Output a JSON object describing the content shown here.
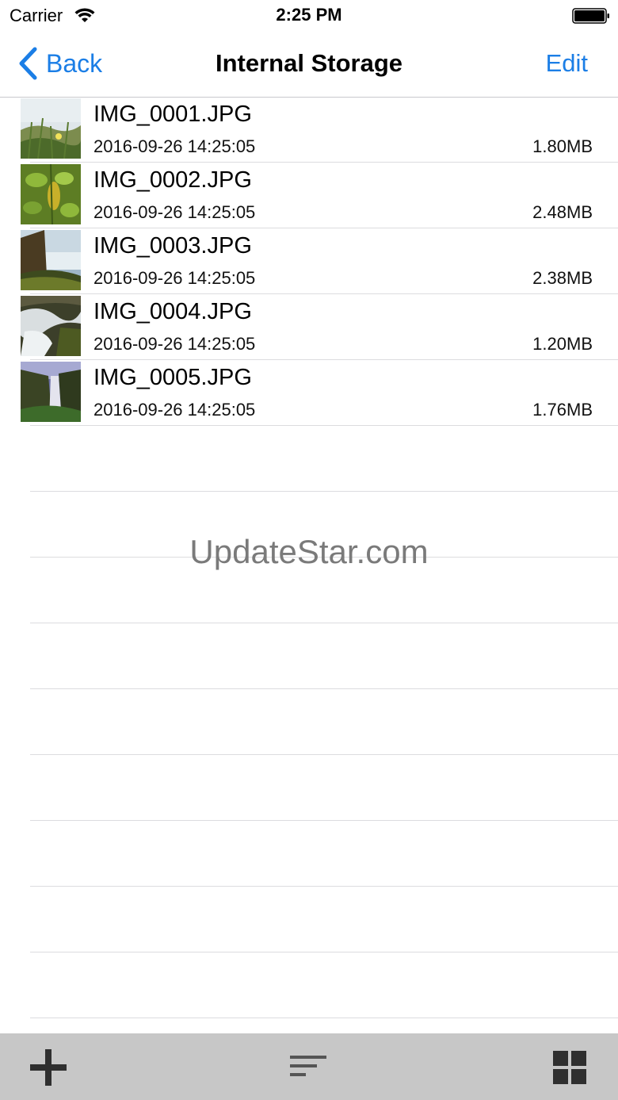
{
  "status_bar": {
    "carrier": "Carrier",
    "time": "2:25 PM"
  },
  "nav": {
    "back_label": "Back",
    "title": "Internal Storage",
    "edit_label": "Edit"
  },
  "files": [
    {
      "name": "IMG_0001.JPG",
      "date": "2016-09-26 14:25:05",
      "size": "1.80MB"
    },
    {
      "name": "IMG_0002.JPG",
      "date": "2016-09-26 14:25:05",
      "size": "2.48MB"
    },
    {
      "name": "IMG_0003.JPG",
      "date": "2016-09-26 14:25:05",
      "size": "2.38MB"
    },
    {
      "name": "IMG_0004.JPG",
      "date": "2016-09-26 14:25:05",
      "size": "1.20MB"
    },
    {
      "name": "IMG_0005.JPG",
      "date": "2016-09-26 14:25:05",
      "size": "1.76MB"
    }
  ],
  "watermark": "UpdateStar.com",
  "toolbar": {
    "icons": [
      "plus-icon",
      "sort-icon",
      "grid-icon"
    ]
  },
  "colors": {
    "accent": "#1b7ee6",
    "toolbar_bg": "#c7c7c7",
    "separator": "#dcdcdf"
  }
}
